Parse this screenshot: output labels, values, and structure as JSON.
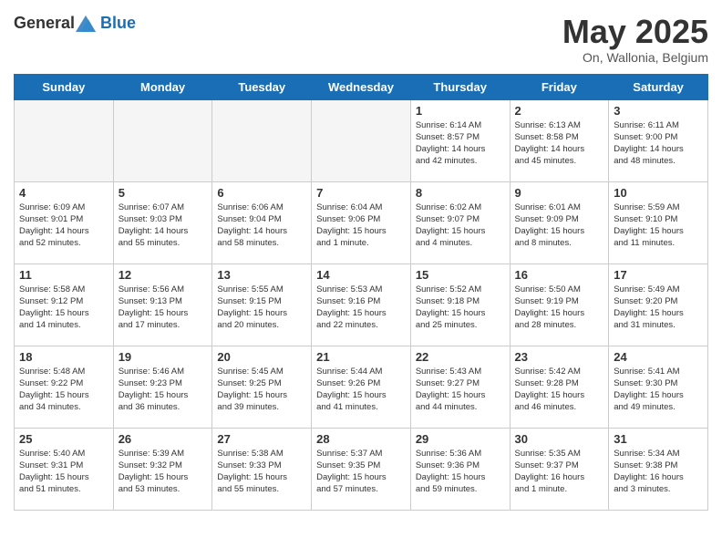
{
  "header": {
    "logo_general": "General",
    "logo_blue": "Blue",
    "title": "May 2025",
    "subtitle": "On, Wallonia, Belgium"
  },
  "days_of_week": [
    "Sunday",
    "Monday",
    "Tuesday",
    "Wednesday",
    "Thursday",
    "Friday",
    "Saturday"
  ],
  "weeks": [
    [
      {
        "num": "",
        "info": ""
      },
      {
        "num": "",
        "info": ""
      },
      {
        "num": "",
        "info": ""
      },
      {
        "num": "",
        "info": ""
      },
      {
        "num": "1",
        "info": "Sunrise: 6:14 AM\nSunset: 8:57 PM\nDaylight: 14 hours\nand 42 minutes."
      },
      {
        "num": "2",
        "info": "Sunrise: 6:13 AM\nSunset: 8:58 PM\nDaylight: 14 hours\nand 45 minutes."
      },
      {
        "num": "3",
        "info": "Sunrise: 6:11 AM\nSunset: 9:00 PM\nDaylight: 14 hours\nand 48 minutes."
      }
    ],
    [
      {
        "num": "4",
        "info": "Sunrise: 6:09 AM\nSunset: 9:01 PM\nDaylight: 14 hours\nand 52 minutes."
      },
      {
        "num": "5",
        "info": "Sunrise: 6:07 AM\nSunset: 9:03 PM\nDaylight: 14 hours\nand 55 minutes."
      },
      {
        "num": "6",
        "info": "Sunrise: 6:06 AM\nSunset: 9:04 PM\nDaylight: 14 hours\nand 58 minutes."
      },
      {
        "num": "7",
        "info": "Sunrise: 6:04 AM\nSunset: 9:06 PM\nDaylight: 15 hours\nand 1 minute."
      },
      {
        "num": "8",
        "info": "Sunrise: 6:02 AM\nSunset: 9:07 PM\nDaylight: 15 hours\nand 4 minutes."
      },
      {
        "num": "9",
        "info": "Sunrise: 6:01 AM\nSunset: 9:09 PM\nDaylight: 15 hours\nand 8 minutes."
      },
      {
        "num": "10",
        "info": "Sunrise: 5:59 AM\nSunset: 9:10 PM\nDaylight: 15 hours\nand 11 minutes."
      }
    ],
    [
      {
        "num": "11",
        "info": "Sunrise: 5:58 AM\nSunset: 9:12 PM\nDaylight: 15 hours\nand 14 minutes."
      },
      {
        "num": "12",
        "info": "Sunrise: 5:56 AM\nSunset: 9:13 PM\nDaylight: 15 hours\nand 17 minutes."
      },
      {
        "num": "13",
        "info": "Sunrise: 5:55 AM\nSunset: 9:15 PM\nDaylight: 15 hours\nand 20 minutes."
      },
      {
        "num": "14",
        "info": "Sunrise: 5:53 AM\nSunset: 9:16 PM\nDaylight: 15 hours\nand 22 minutes."
      },
      {
        "num": "15",
        "info": "Sunrise: 5:52 AM\nSunset: 9:18 PM\nDaylight: 15 hours\nand 25 minutes."
      },
      {
        "num": "16",
        "info": "Sunrise: 5:50 AM\nSunset: 9:19 PM\nDaylight: 15 hours\nand 28 minutes."
      },
      {
        "num": "17",
        "info": "Sunrise: 5:49 AM\nSunset: 9:20 PM\nDaylight: 15 hours\nand 31 minutes."
      }
    ],
    [
      {
        "num": "18",
        "info": "Sunrise: 5:48 AM\nSunset: 9:22 PM\nDaylight: 15 hours\nand 34 minutes."
      },
      {
        "num": "19",
        "info": "Sunrise: 5:46 AM\nSunset: 9:23 PM\nDaylight: 15 hours\nand 36 minutes."
      },
      {
        "num": "20",
        "info": "Sunrise: 5:45 AM\nSunset: 9:25 PM\nDaylight: 15 hours\nand 39 minutes."
      },
      {
        "num": "21",
        "info": "Sunrise: 5:44 AM\nSunset: 9:26 PM\nDaylight: 15 hours\nand 41 minutes."
      },
      {
        "num": "22",
        "info": "Sunrise: 5:43 AM\nSunset: 9:27 PM\nDaylight: 15 hours\nand 44 minutes."
      },
      {
        "num": "23",
        "info": "Sunrise: 5:42 AM\nSunset: 9:28 PM\nDaylight: 15 hours\nand 46 minutes."
      },
      {
        "num": "24",
        "info": "Sunrise: 5:41 AM\nSunset: 9:30 PM\nDaylight: 15 hours\nand 49 minutes."
      }
    ],
    [
      {
        "num": "25",
        "info": "Sunrise: 5:40 AM\nSunset: 9:31 PM\nDaylight: 15 hours\nand 51 minutes."
      },
      {
        "num": "26",
        "info": "Sunrise: 5:39 AM\nSunset: 9:32 PM\nDaylight: 15 hours\nand 53 minutes."
      },
      {
        "num": "27",
        "info": "Sunrise: 5:38 AM\nSunset: 9:33 PM\nDaylight: 15 hours\nand 55 minutes."
      },
      {
        "num": "28",
        "info": "Sunrise: 5:37 AM\nSunset: 9:35 PM\nDaylight: 15 hours\nand 57 minutes."
      },
      {
        "num": "29",
        "info": "Sunrise: 5:36 AM\nSunset: 9:36 PM\nDaylight: 15 hours\nand 59 minutes."
      },
      {
        "num": "30",
        "info": "Sunrise: 5:35 AM\nSunset: 9:37 PM\nDaylight: 16 hours\nand 1 minute."
      },
      {
        "num": "31",
        "info": "Sunrise: 5:34 AM\nSunset: 9:38 PM\nDaylight: 16 hours\nand 3 minutes."
      }
    ]
  ]
}
